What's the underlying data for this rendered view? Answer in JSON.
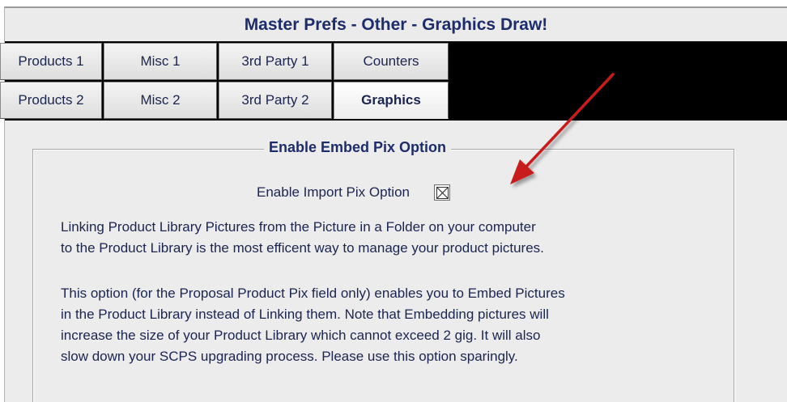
{
  "window": {
    "title": "Master Prefs - Other - Graphics Draw!"
  },
  "tabs": {
    "row1": [
      {
        "label": "Products 1"
      },
      {
        "label": "Misc 1"
      },
      {
        "label": "3rd Party 1"
      },
      {
        "label": "Counters"
      }
    ],
    "row2": [
      {
        "label": "Products 2"
      },
      {
        "label": "Misc 2"
      },
      {
        "label": "3rd Party 2"
      },
      {
        "label": "Graphics",
        "selected": true
      }
    ]
  },
  "group": {
    "title": "Enable Embed Pix Option",
    "checkbox_label": "Enable Import Pix Option",
    "checkbox_checked": true,
    "paragraph1_line1": "Linking Product Library Pictures from the Picture in a Folder on your computer",
    "paragraph1_line2": "to the Product Library is the most efficent way to manage your product pictures.",
    "paragraph2_line1": "This option (for the Proposal Product Pix field only) enables you to Embed Pictures",
    "paragraph2_line2": "in the Product Library instead of Linking them.  Note that Embedding pictures will",
    "paragraph2_line3": "increase the size of your Product Library which cannot exceed 2 gig. It will also",
    "paragraph2_line4": "slow down your SCPS upgrading process. Please use this option sparingly."
  },
  "colors": {
    "title_text": "#1d2c6a",
    "tab_bar_bg": "#000000",
    "panel_bg": "#ececec",
    "annotation_arrow": "#c81f1f"
  },
  "icons": {
    "checkbox_mark": "x-mark-icon",
    "annotation": "red-arrow-icon"
  }
}
